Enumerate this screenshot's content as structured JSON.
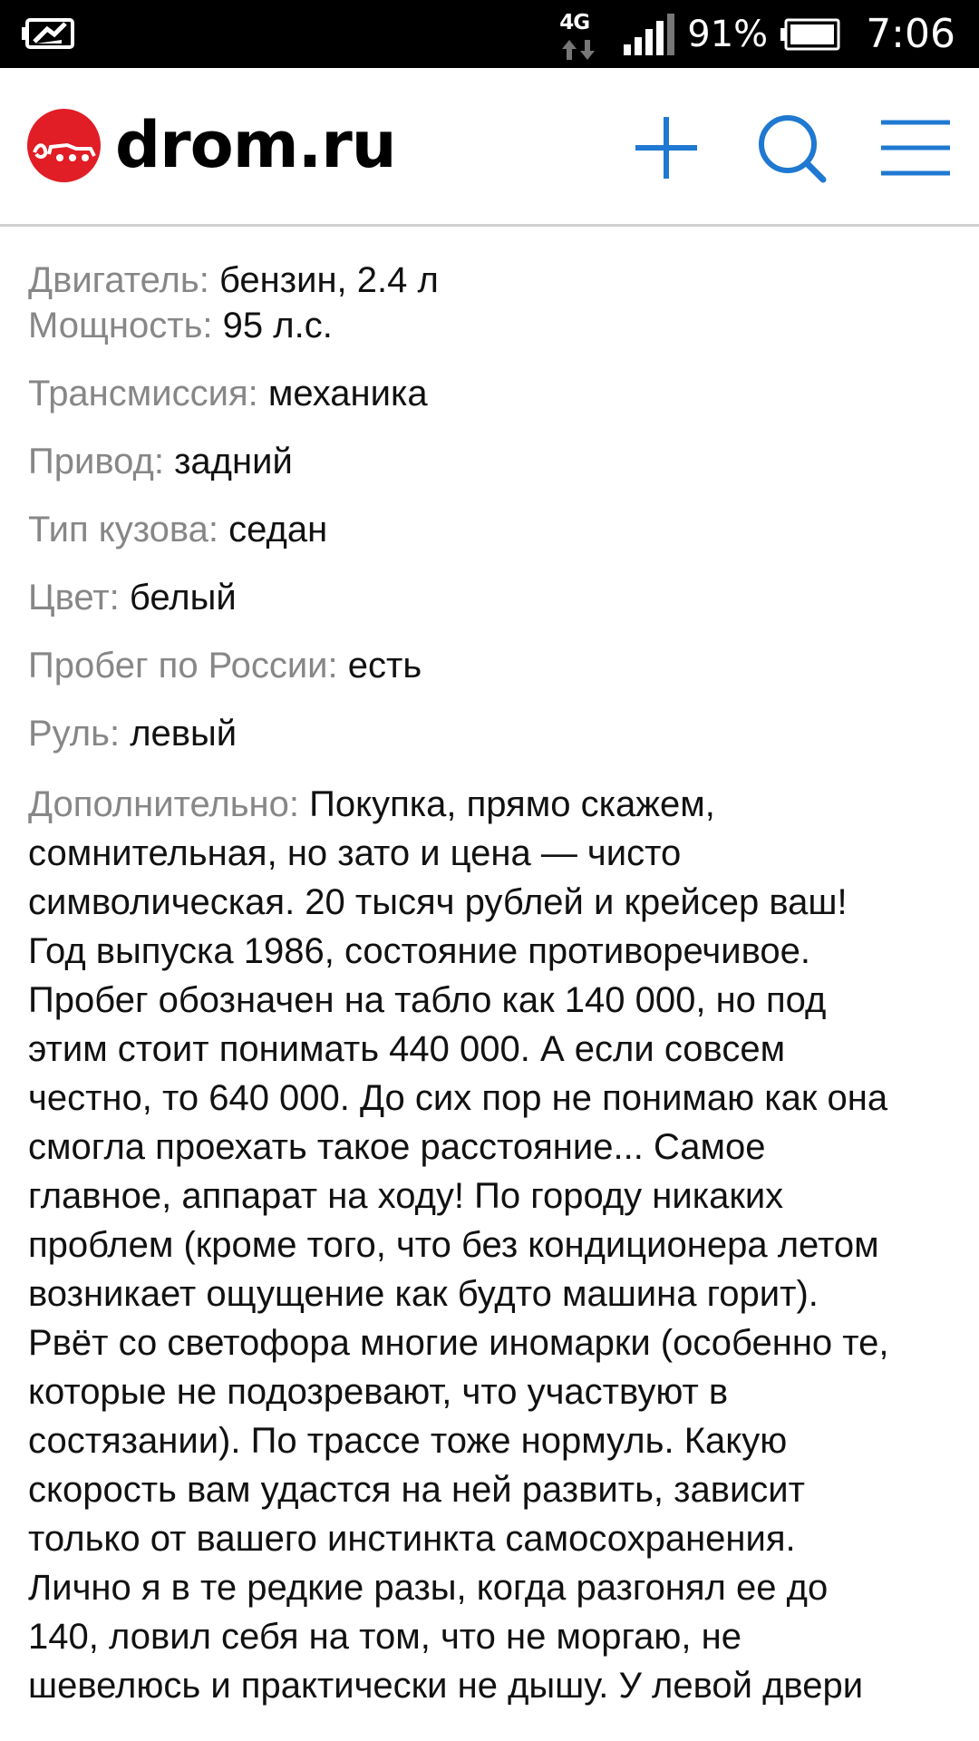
{
  "status_bar": {
    "network": "4G",
    "battery_percent": "91%",
    "time": "7:06",
    "icons": [
      "notification-card-icon",
      "network-4g-icon",
      "signal-icon",
      "battery-icon"
    ]
  },
  "header": {
    "logo_text": "drom.ru",
    "logo_color": "#e11d26",
    "accent_color": "#1f78d1",
    "icons": [
      "add-icon",
      "search-icon",
      "menu-icon"
    ]
  },
  "specs": [
    {
      "label": "Двигатель:",
      "value": "бензин, 2.4 л"
    },
    {
      "label": "Мощность:",
      "value": "95 л.с."
    },
    {
      "label": "Трансмиссия:",
      "value": "механика"
    },
    {
      "label": "Привод:",
      "value": "задний"
    },
    {
      "label": "Тип кузова:",
      "value": "седан"
    },
    {
      "label": "Цвет:",
      "value": "белый"
    },
    {
      "label": "Пробег по России:",
      "value": "есть"
    },
    {
      "label": "Руль:",
      "value": "левый"
    }
  ],
  "description": {
    "label": "Дополнительно:",
    "lines": [
      "Покупка, прямо скажем,",
      "сомнительная, но зато и цена — чисто",
      "символическая. 20 тысяч рублей и крейсер ваш!",
      "Год выпуска 1986, состояние противоречивое.",
      "Пробег обозначен на табло как 140 000, но под",
      "этим стоит понимать 440 000. А если совсем",
      "честно, то 640 000. До сих пор не понимаю как она",
      "смогла проехать такое расстояние... Самое",
      "главное, аппарат на ходу! По городу никаких",
      "проблем (кроме того, что без кондиционера летом",
      "возникает ощущение как будто машина горит).",
      "Рвёт со светофора многие иномарки (особенно те,",
      "которые не подозревают, что участвуют в",
      "состязании). По трассе тоже нормуль. Какую",
      "скорость вам удастся на ней развить, зависит",
      "только от вашего инстинкта самосохранения.",
      "Лично я в те редкие разы, когда разгонял ее до",
      "140, ловил себя на том, что не моргаю, не",
      "шевелюсь и практически не дышу. У левой двери"
    ]
  }
}
